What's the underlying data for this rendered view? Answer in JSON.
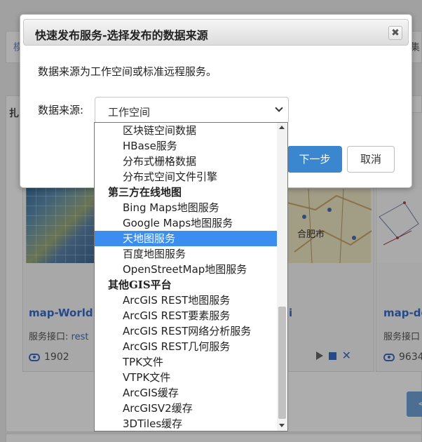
{
  "background": {
    "crumb_left": "模",
    "crumb_right": "集",
    "panel_tag": "扎",
    "cards": [
      {
        "title": "map-World",
        "iface_label": "服务接口: ",
        "iface_link": "rest",
        "views": "1902"
      },
      {
        "title": "i",
        "map_label": "合肥市"
      },
      {
        "title": "map-de",
        "iface_label": "服务接口",
        "views": "9634"
      }
    ],
    "pager_label": "<"
  },
  "modal": {
    "title": "快速发布服务-选择发布的数据来源",
    "close_label": "✖",
    "description": "数据来源为工作空间或标准远程服务。",
    "field_label": "数据来源:",
    "selected_value": "工作空间",
    "next_label": "下一步",
    "cancel_label": "取消"
  },
  "dropdown": {
    "items": [
      {
        "label": "区块链空间数据",
        "type": "option"
      },
      {
        "label": "HBase服务",
        "type": "option"
      },
      {
        "label": "分布式栅格数据",
        "type": "option"
      },
      {
        "label": "分布式空间文件引擎",
        "type": "option"
      },
      {
        "label": "第三方在线地图",
        "type": "group"
      },
      {
        "label": "Bing Maps地图服务",
        "type": "option"
      },
      {
        "label": "Google Maps地图服务",
        "type": "option"
      },
      {
        "label": "天地图服务",
        "type": "option",
        "selected": true
      },
      {
        "label": "百度地图服务",
        "type": "option"
      },
      {
        "label": "OpenStreetMap地图服务",
        "type": "option"
      },
      {
        "label": "其他GIS平台",
        "type": "group"
      },
      {
        "label": "ArcGIS REST地图服务",
        "type": "option"
      },
      {
        "label": "ArcGIS REST要素服务",
        "type": "option"
      },
      {
        "label": "ArcGIS REST网络分析服务",
        "type": "option"
      },
      {
        "label": "ArcGIS REST几何服务",
        "type": "option"
      },
      {
        "label": "TPK文件",
        "type": "option"
      },
      {
        "label": "VTPK文件",
        "type": "option"
      },
      {
        "label": "ArcGIS缓存",
        "type": "option"
      },
      {
        "label": "ArcGISV2缓存",
        "type": "option"
      },
      {
        "label": "3DTiles缓存",
        "type": "option"
      }
    ]
  },
  "colors": {
    "primary": "#3a87cf",
    "selected_option": "#3b8ef0",
    "link": "#3b6cc7"
  }
}
